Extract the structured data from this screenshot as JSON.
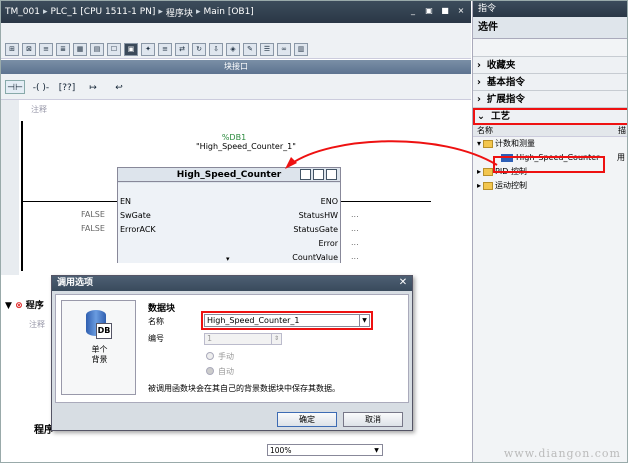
{
  "window": {
    "breadcrumb": [
      "TM_001",
      "PLC_1 [CPU 1511-1 PN]",
      "程序块",
      "Main [OB1]"
    ],
    "controls": [
      "_",
      "▣",
      "■",
      "×"
    ]
  },
  "toolbar": {
    "icons": [
      "insert-network-icon",
      "delete-network-icon",
      "expand-icon",
      "collapse-icon",
      "absolute-operand-icon",
      "favorites-icon",
      "box-icon",
      "call-structure-icon",
      "monitor-icon",
      "go-online-icon",
      "compare-icon",
      "refresh-icon",
      "download-icon",
      "snapshot-icon",
      "network-comment-icon",
      "symbolic-icon",
      "monitor-on-icon",
      "extended-icon"
    ]
  },
  "interface_bar": {
    "label": "块接口"
  },
  "ladder_tools": [
    "contact",
    "coil",
    "box",
    "branch-open",
    "branch-close"
  ],
  "editor": {
    "comment_label": "注释",
    "db_name": "%DB1",
    "db_instance": "\"High_Speed_Counter_1\"",
    "block_title": "High_Speed_Counter",
    "pins_left": [
      {
        "name": "EN",
        "value": ""
      },
      {
        "name": "SwGate",
        "value": "FALSE"
      },
      {
        "name": "ErrorACK",
        "value": "FALSE"
      }
    ],
    "pins_right": [
      {
        "name": "ENO",
        "value": ""
      },
      {
        "name": "StatusHW",
        "value": "..."
      },
      {
        "name": "StatusGate",
        "value": "..."
      },
      {
        "name": "Error",
        "value": "..."
      },
      {
        "name": "CountValue",
        "value": "..."
      }
    ],
    "lower_network_label": "程序",
    "lower_comment": "注释",
    "lower_title": "程序",
    "zoom": "100%"
  },
  "instructions": {
    "pane_title": "指令",
    "selection_label": "选件",
    "sections": [
      {
        "label": "收藏夹",
        "expanded": false
      },
      {
        "label": "基本指令",
        "expanded": false
      },
      {
        "label": "扩展指令",
        "expanded": false
      },
      {
        "label": "工艺",
        "expanded": true
      }
    ],
    "columns": {
      "name": "名称",
      "desc": "描"
    },
    "tree": [
      {
        "label": "计数和测量",
        "level": 1,
        "type": "folder",
        "expanded": true
      },
      {
        "label": "High_Speed_Counter",
        "level": 2,
        "type": "fb",
        "extra": "用"
      },
      {
        "label": "PID 控制",
        "level": 1,
        "type": "folder",
        "expanded": false
      },
      {
        "label": "运动控制",
        "level": 1,
        "type": "folder",
        "expanded": false
      }
    ]
  },
  "dialog": {
    "title": "调用选项",
    "tile_caption_1": "单个",
    "tile_caption_2": "背景",
    "tile_badge": "DB",
    "group_title": "数据块",
    "name_label": "名称",
    "name_value": "High_Speed_Counter_1",
    "number_label": "编号",
    "number_value": "1",
    "radio_manual": "手动",
    "radio_auto": "自动",
    "note": "被调用函数块会在其自己的背景数据块中保存其数据。",
    "ok_label": "确定",
    "cancel_label": "取消"
  },
  "watermark": "www.diangon.com",
  "colors": {
    "title_bar": "#2f3e4e",
    "highlight": "#e11111",
    "db_green": "#2b8a3e",
    "fb_blue": "#2d5fb6"
  }
}
